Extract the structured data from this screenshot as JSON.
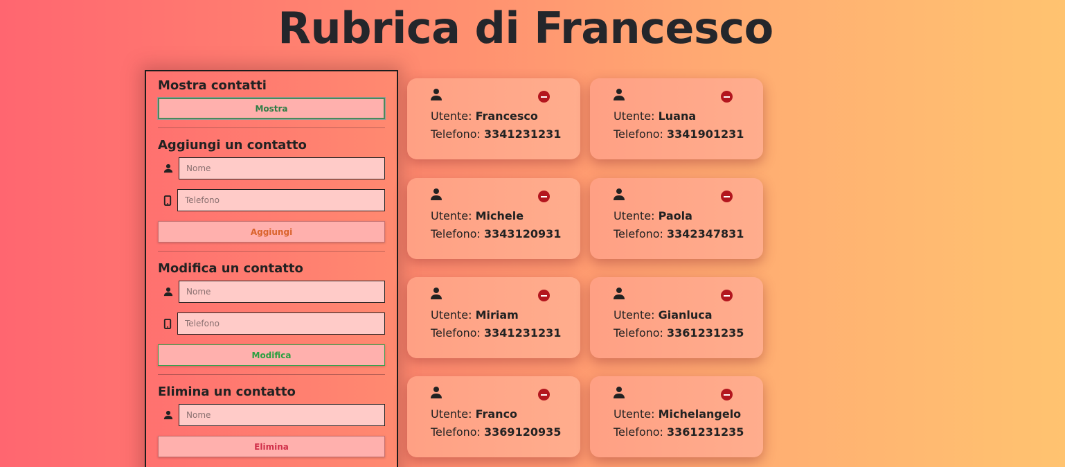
{
  "title": "Rubrica di Francesco",
  "sidebar": {
    "show": {
      "heading": "Mostra contatti",
      "button": "Mostra"
    },
    "add": {
      "heading": "Aggiungi un contatto",
      "name_placeholder": "Nome",
      "phone_placeholder": "Telefono",
      "button": "Aggiungi"
    },
    "edit": {
      "heading": "Modifica un contatto",
      "name_placeholder": "Nome",
      "phone_placeholder": "Telefono",
      "button": "Modifica"
    },
    "delete": {
      "heading": "Elimina un contatto",
      "name_placeholder": "Nome",
      "button": "Elimina"
    }
  },
  "labels": {
    "user": "Utente:",
    "phone": "Telefono:"
  },
  "icons": {
    "user": "user-icon",
    "phone": "mobile-phone-icon",
    "remove": "remove-circle-icon"
  },
  "colors": {
    "remove": "#b3161e",
    "show_text": "#2e7d46",
    "add_text": "#d9622a",
    "edit_text": "#2aa040",
    "delete_text": "#d0304a"
  },
  "contacts": [
    {
      "name": "Francesco",
      "phone": "3341231231"
    },
    {
      "name": "Luana",
      "phone": "3341901231"
    },
    {
      "name": "Michele",
      "phone": "3343120931"
    },
    {
      "name": "Paola",
      "phone": "3342347831"
    },
    {
      "name": "Miriam",
      "phone": "3341231231"
    },
    {
      "name": "Gianluca",
      "phone": "3361231235"
    },
    {
      "name": "Franco",
      "phone": "3369120935"
    },
    {
      "name": "Michelangelo",
      "phone": "3361231235"
    }
  ]
}
